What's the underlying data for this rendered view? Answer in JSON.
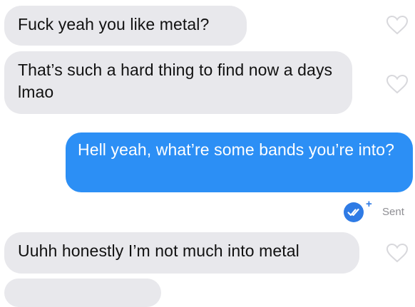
{
  "conversation": {
    "messages": [
      {
        "direction": "incoming",
        "text": "Fuck yeah you like metal?"
      },
      {
        "direction": "incoming",
        "text": "That’s such a hard thing to find now a days lmao"
      },
      {
        "direction": "outgoing",
        "text": "Hell yeah, what’re some bands you’re into?"
      },
      {
        "direction": "incoming",
        "text": "Uuhh honestly I’m not much into metal"
      }
    ],
    "delivery_status": {
      "icon": "double-check-badge-icon",
      "plus": "+",
      "label": "Sent"
    }
  },
  "colors": {
    "incoming_bubble": "#e8e8ec",
    "outgoing_bubble": "#2c8ff5",
    "status_accent": "#2f7be5"
  }
}
